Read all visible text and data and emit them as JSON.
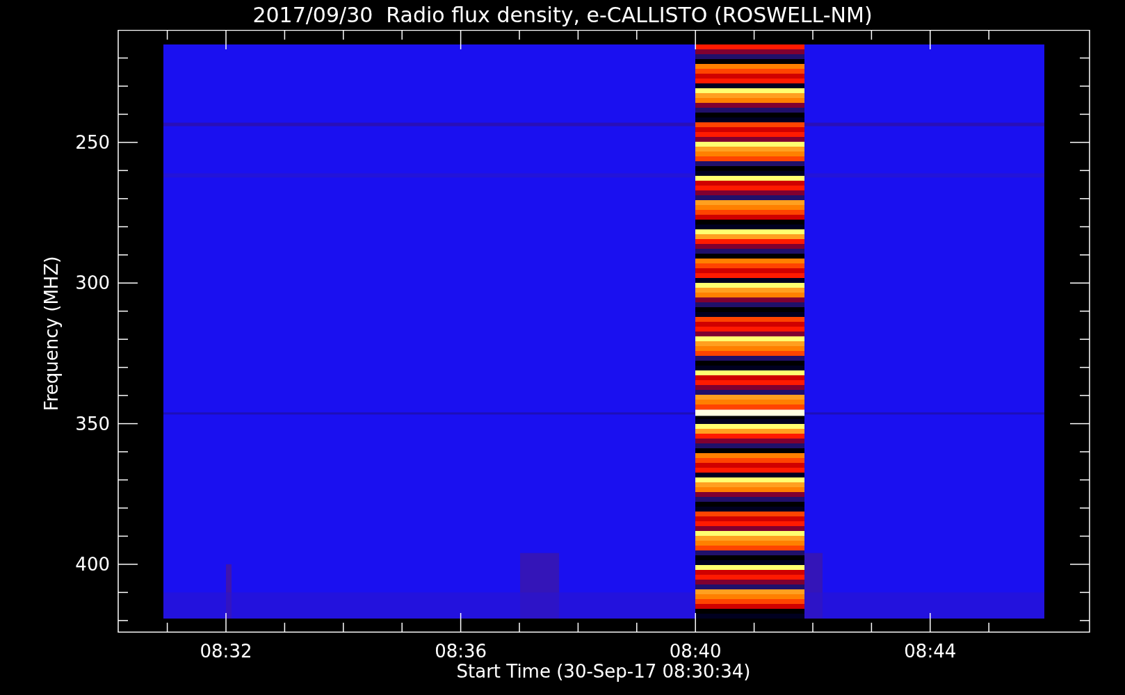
{
  "title": "2017/09/30  Radio flux density, e-CALLISTO (ROSWELL-NM)",
  "y_axis": {
    "label": "Frequency (MHZ)",
    "ticks": [
      "250",
      "300",
      "350",
      "400"
    ]
  },
  "x_axis": {
    "label": "Start Time (30-Sep-17 08:30:34)",
    "ticks": [
      "08:32",
      "08:36",
      "08:40",
      "08:44"
    ]
  }
}
